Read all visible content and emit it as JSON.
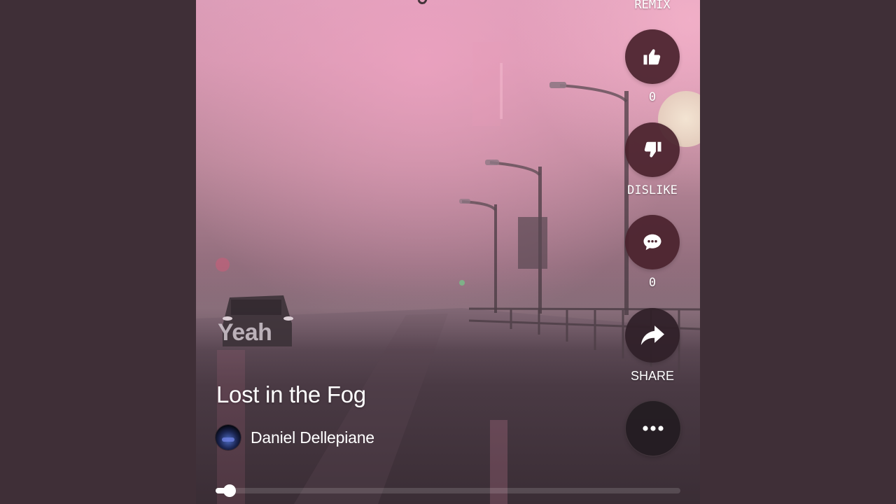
{
  "song": {
    "lyric_overlay": "Yeah",
    "title": "Lost in the Fog",
    "artist": "Daniel Dellepiane"
  },
  "actions": {
    "remix_label": "REMIX",
    "like_count": "0",
    "dislike_label": "DISLIKE",
    "comment_count": "0",
    "share_label": "SHARE"
  },
  "icons": {
    "like": "thumbs-up-icon",
    "dislike": "thumbs-down-icon",
    "comment": "comment-bubble-icon",
    "share": "share-arrow-icon",
    "more": "more-horizontal-icon"
  },
  "playback": {
    "progress_fraction": 0.03
  },
  "colors": {
    "page_background": "#3f2f37",
    "button_background": "#4a222d",
    "text": "#ffffff"
  }
}
